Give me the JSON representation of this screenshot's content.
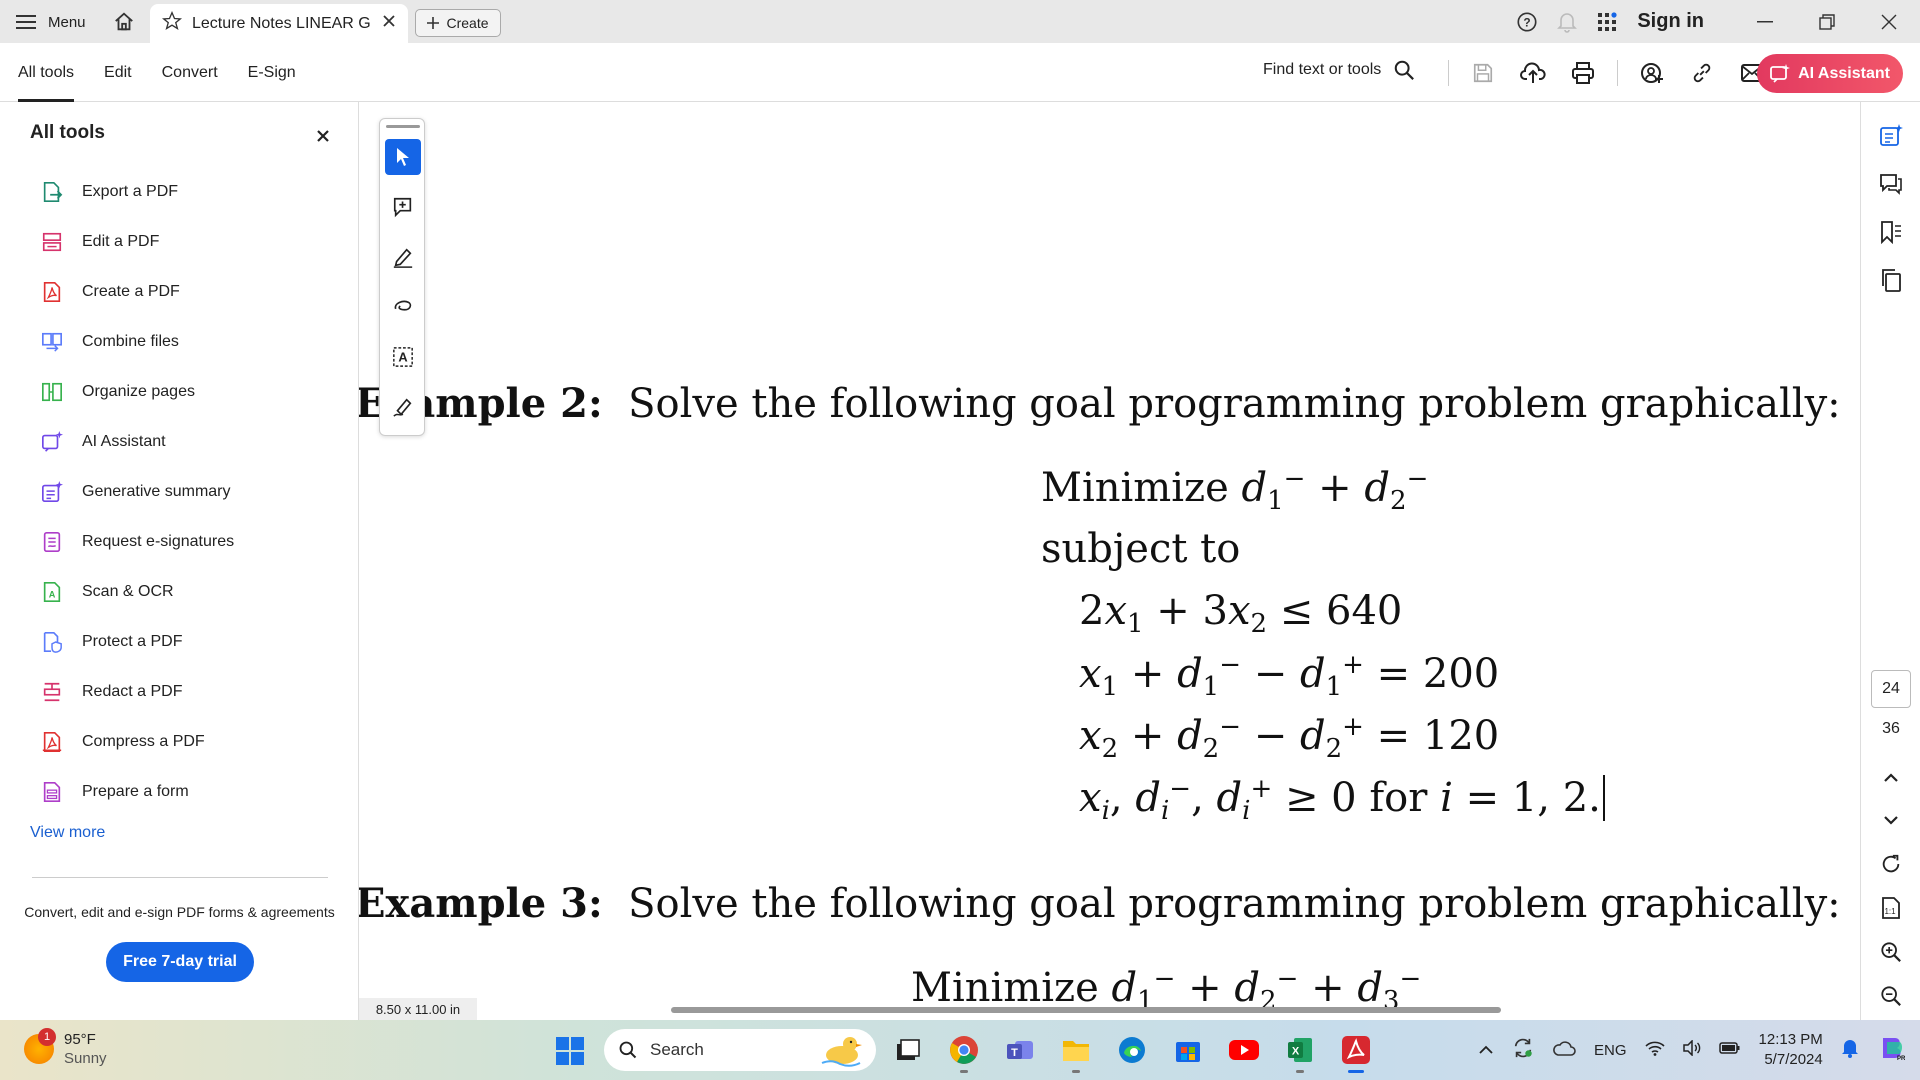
{
  "titlebar": {
    "menu_label": "Menu",
    "tab_title": "Lecture Notes LINEAR G...",
    "create_label": "Create",
    "sign_in": "Sign in"
  },
  "toolbar": {
    "tabs": [
      "All tools",
      "Edit",
      "Convert",
      "E-Sign"
    ],
    "find_label": "Find text or tools",
    "ai_label": "AI Assistant"
  },
  "left_panel": {
    "title": "All tools",
    "items": [
      {
        "label": "Export a PDF",
        "icon": "export-pdf-icon",
        "color": "#1f8a70"
      },
      {
        "label": "Edit a PDF",
        "icon": "edit-pdf-icon",
        "color": "#d6336c"
      },
      {
        "label": "Create a PDF",
        "icon": "create-pdf-icon",
        "color": "#e03131"
      },
      {
        "label": "Combine files",
        "icon": "combine-files-icon",
        "color": "#5c7cfa"
      },
      {
        "label": "Organize pages",
        "icon": "organize-pages-icon",
        "color": "#37b24d"
      },
      {
        "label": "AI Assistant",
        "icon": "ai-assistant-icon",
        "color": "#7048e8"
      },
      {
        "label": "Generative summary",
        "icon": "generative-summary-icon",
        "color": "#7048e8"
      },
      {
        "label": "Request e-signatures",
        "icon": "request-esign-icon",
        "color": "#ae3ec9"
      },
      {
        "label": "Scan & OCR",
        "icon": "scan-ocr-icon",
        "color": "#37b24d"
      },
      {
        "label": "Protect a PDF",
        "icon": "protect-pdf-icon",
        "color": "#5c7cfa"
      },
      {
        "label": "Redact a PDF",
        "icon": "redact-pdf-icon",
        "color": "#d6336c"
      },
      {
        "label": "Compress a PDF",
        "icon": "compress-pdf-icon",
        "color": "#e03131"
      },
      {
        "label": "Prepare a form",
        "icon": "prepare-form-icon",
        "color": "#ae3ec9"
      }
    ],
    "view_more": "View more",
    "promo_text": "Convert, edit and e-sign PDF forms & agreements",
    "trial_button": "Free 7-day trial"
  },
  "document": {
    "example2_label": "Example 2:",
    "example2_text": "Solve the following goal programming problem graphically:",
    "minimize": "Minimize",
    "subject_to": "subject to",
    "example3_label": "Example 3:",
    "example3_text": "Solve the following goal programming problem graphically:",
    "page_size": "8.50 x 11.00 in"
  },
  "right_rail": {
    "current_page": "24",
    "total_pages": "36"
  },
  "taskbar": {
    "weather_temp": "95°F",
    "weather_desc": "Sunny",
    "weather_badge": "1",
    "search_label": "Search",
    "lang": "ENG",
    "time": "12:13 PM",
    "date": "5/7/2024"
  },
  "colors": {
    "accent_blue": "#1565e6",
    "ai_red": "#e2395f"
  }
}
